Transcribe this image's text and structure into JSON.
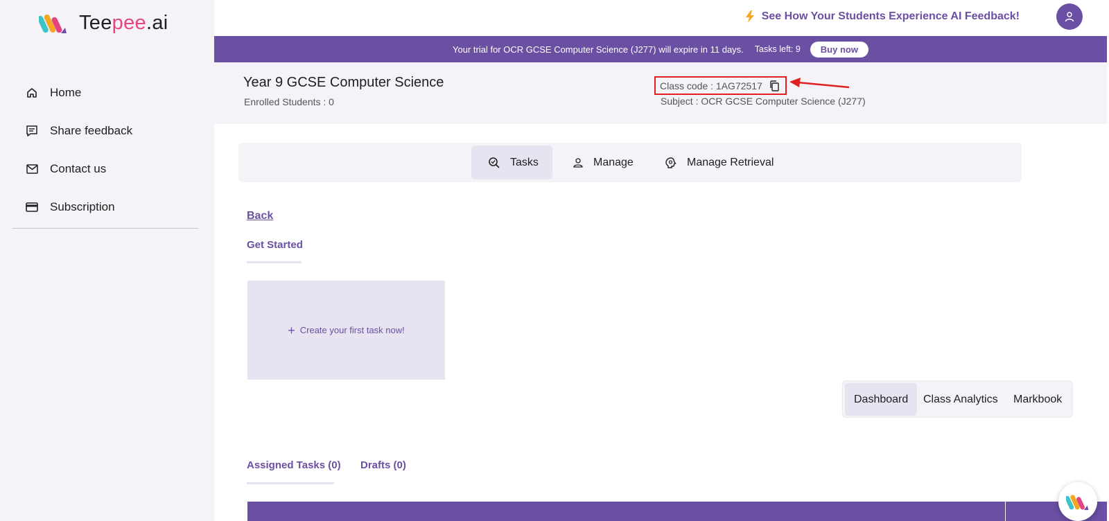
{
  "brand": {
    "name_prefix": "Tee",
    "name_accent": "pee",
    "name_suffix": ".ai"
  },
  "sidebar": {
    "items": [
      {
        "label": "Home",
        "icon": "home-icon"
      },
      {
        "label": "Share feedback",
        "icon": "feedback-icon"
      },
      {
        "label": "Contact us",
        "icon": "mail-icon"
      },
      {
        "label": "Subscription",
        "icon": "card-icon"
      }
    ]
  },
  "topbar": {
    "promo_text": "See How Your Students Experience AI Feedback!",
    "promo_icon": "lightning-icon",
    "avatar_icon": "user-icon"
  },
  "trial": {
    "message": "Your trial for OCR GCSE Computer Science (J277) will expire in 11 days.",
    "tasks_left": "Tasks left: 9",
    "buy_label": "Buy now"
  },
  "class": {
    "title": "Year 9 GCSE Computer Science",
    "enrolled": "Enrolled Students : 0",
    "code": "Class code : 1AG72517",
    "subject": "Subject : OCR GCSE Computer Science (J277)"
  },
  "tabs": [
    {
      "label": "Tasks",
      "active": true
    },
    {
      "label": "Manage",
      "active": false
    },
    {
      "label": "Manage Retrieval",
      "active": false
    }
  ],
  "content": {
    "back_label": "Back",
    "get_started_label": "Get Started",
    "create_task_label": "Create your first task now!"
  },
  "view_switch": [
    {
      "label": "Dashboard",
      "active": true
    },
    {
      "label": "Class Analytics",
      "active": false
    },
    {
      "label": "Markbook",
      "active": false
    }
  ],
  "task_lists": [
    {
      "label": "Assigned Tasks (0)"
    },
    {
      "label": "Drafts (0)"
    }
  ],
  "colors": {
    "primary": "#6a4fa3",
    "accent": "#e54483",
    "highlight": "#e02020",
    "panel": "#f5f2f8"
  }
}
